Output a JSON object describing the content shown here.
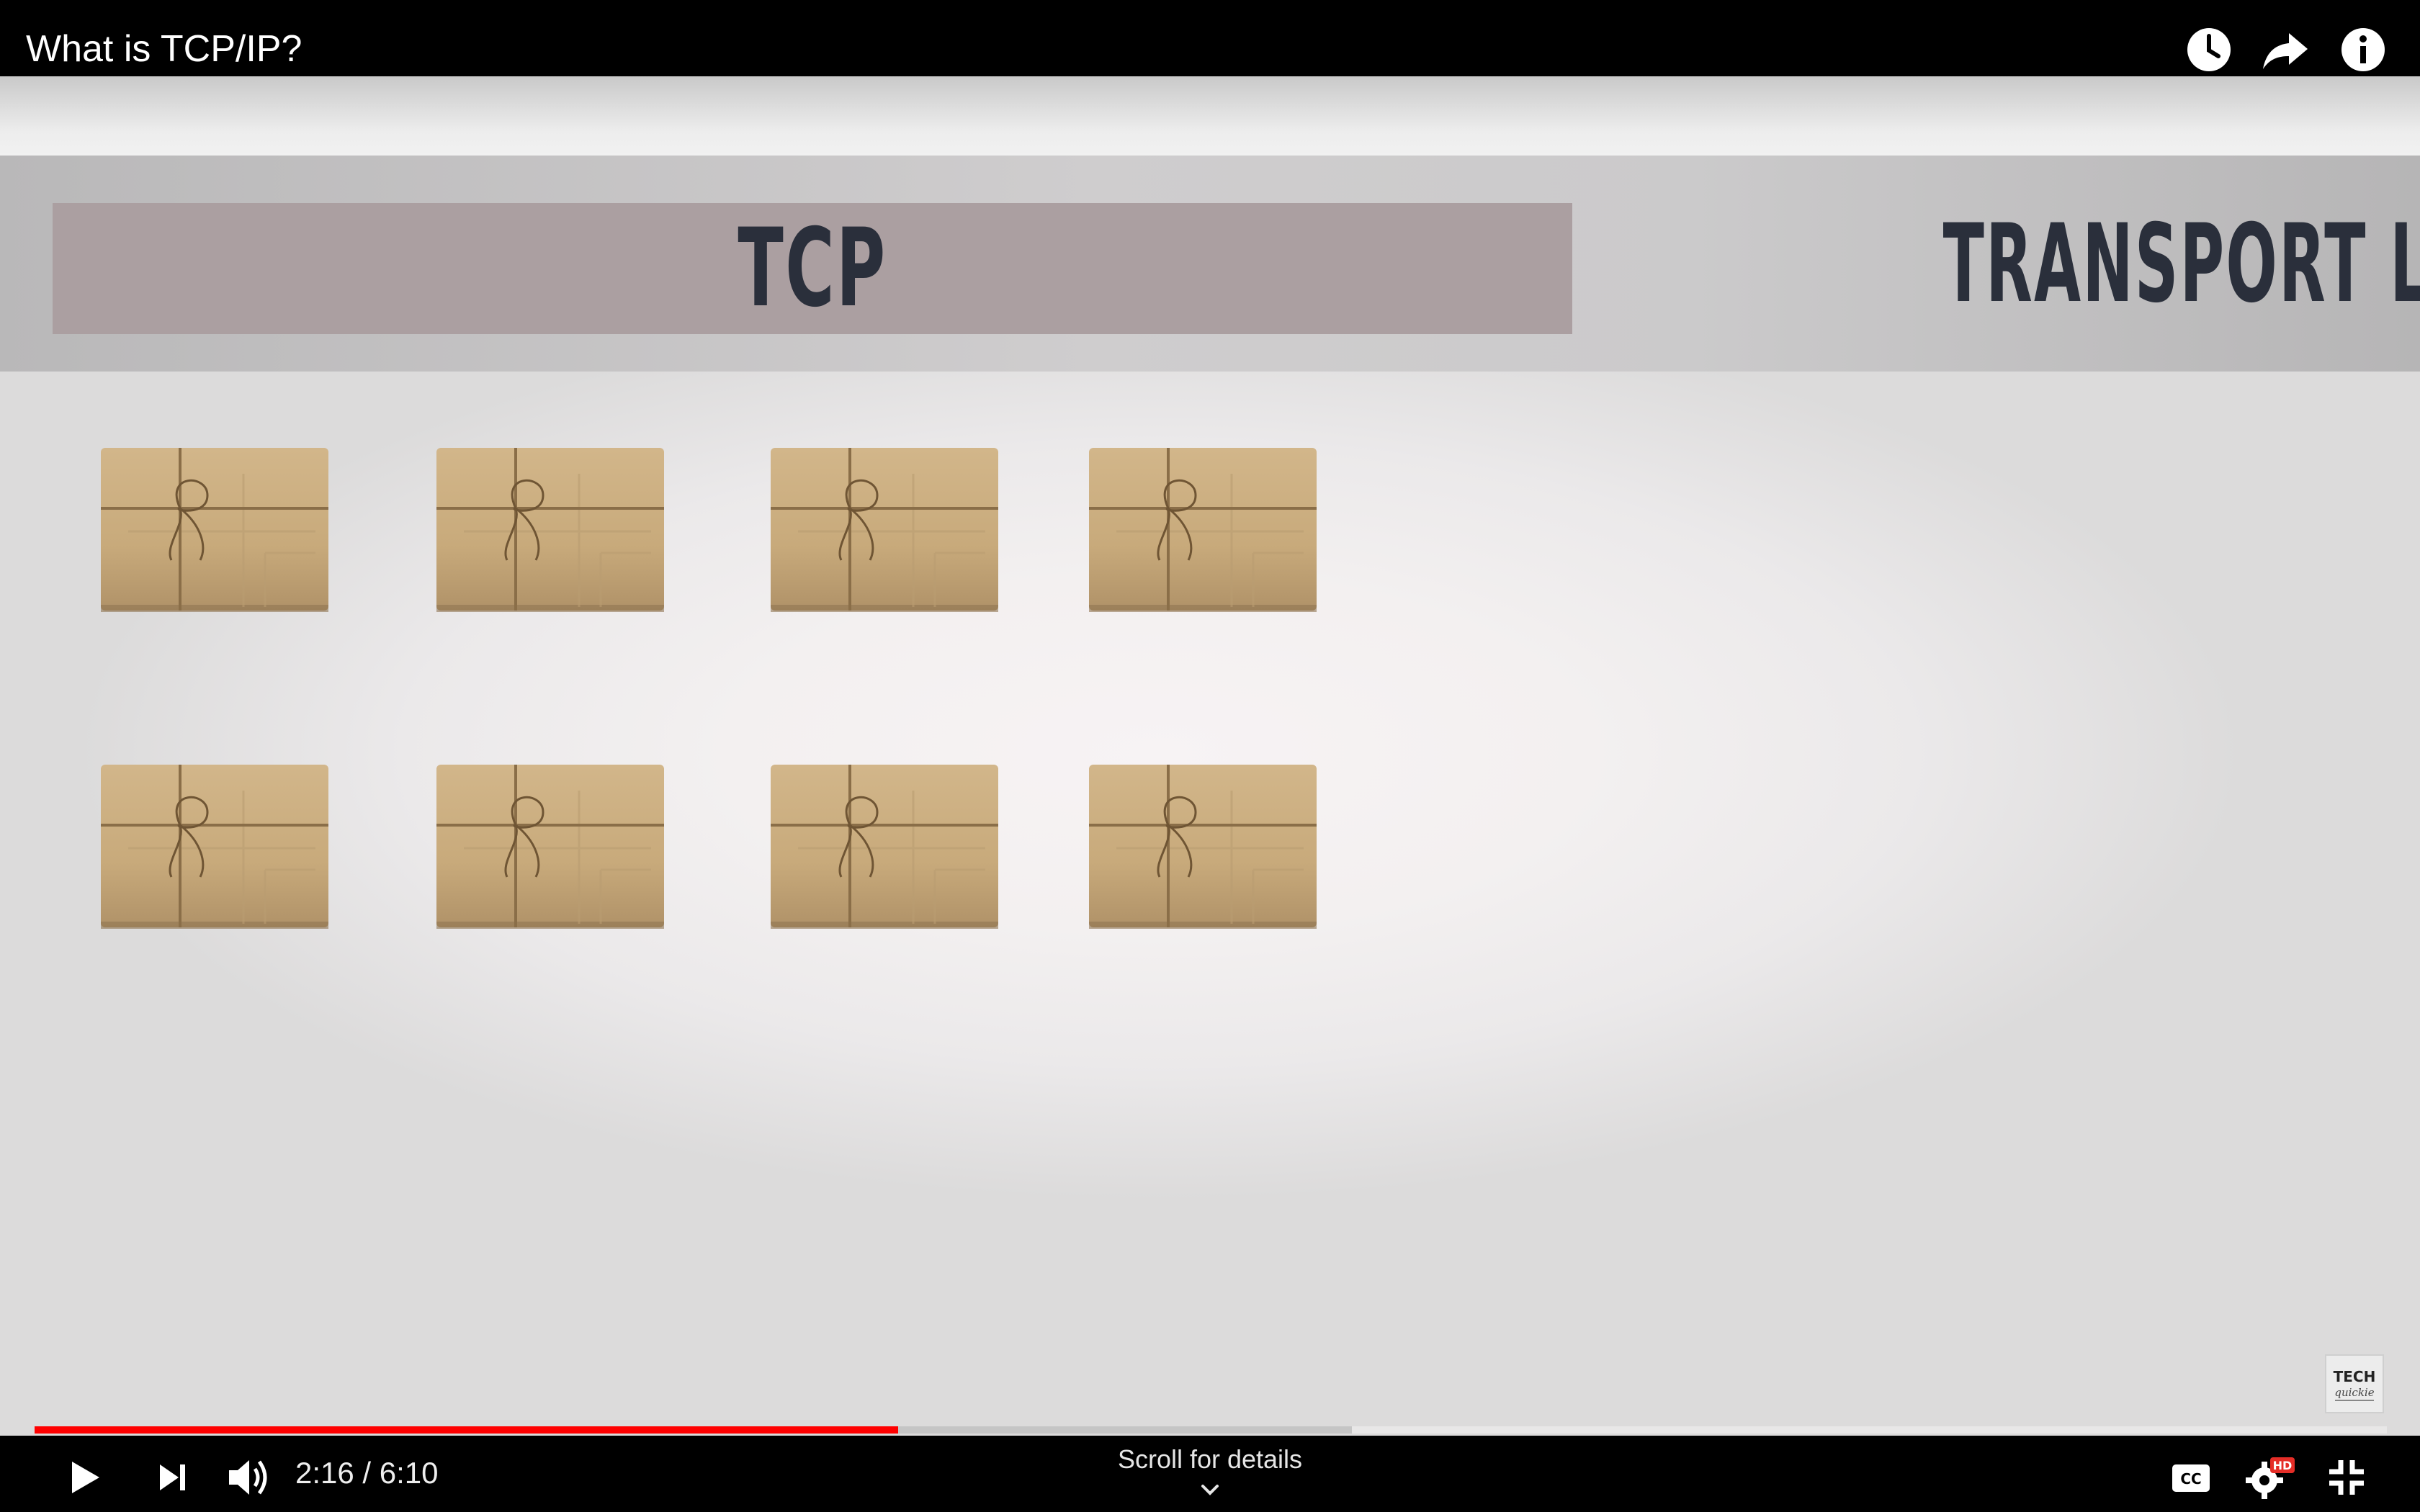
{
  "video": {
    "title": "What is TCP/IP?"
  },
  "top_icons": [
    "watch-later-icon",
    "share-icon",
    "info-icon"
  ],
  "slide": {
    "left_label": "TCP",
    "right_label": "TRANSPORT LAYER",
    "package_count": 8,
    "watermark": "TECH quickie"
  },
  "player": {
    "current_time": "2:16",
    "separator": " / ",
    "duration": "6:10",
    "time_display": "2:16 / 6:10",
    "played_fraction": 0.367,
    "buffered_fraction": 0.56,
    "scroll_hint": "Scroll for details",
    "quality_badge": "HD",
    "played_color": "#ff0000"
  }
}
